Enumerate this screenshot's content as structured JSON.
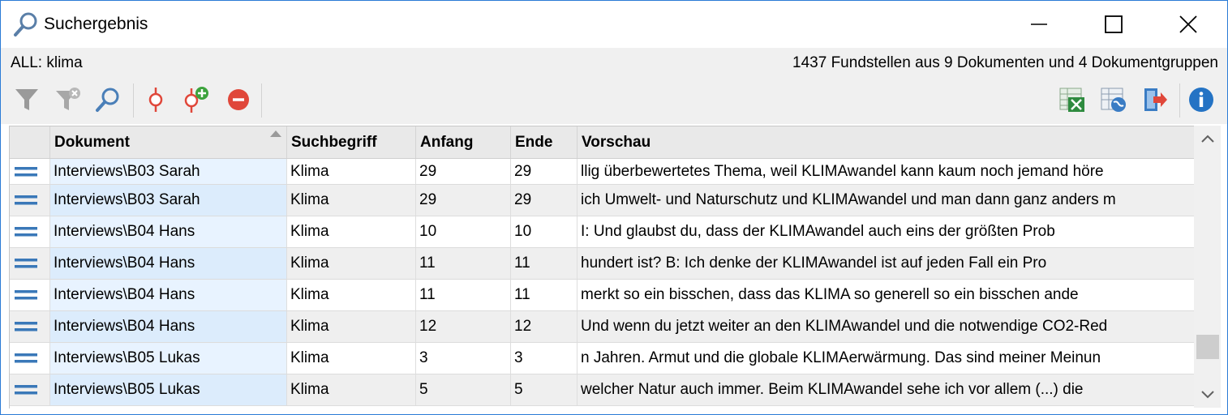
{
  "window": {
    "title": "Suchergebnis",
    "icon": "search-icon",
    "controls": [
      "minimize-icon",
      "maximize-icon",
      "close-icon"
    ]
  },
  "info": {
    "query": "ALL: klima",
    "summary": "1437 Fundstellen aus 9 Dokumenten und 4 Dokumentgruppen"
  },
  "toolbar": {
    "left": [
      "filter-icon",
      "remove-filter-icon",
      "search-icon",
      "code-icon",
      "add-code-icon",
      "remove-icon"
    ],
    "right": [
      "excel-export-icon",
      "web-export-icon",
      "export-icon",
      "info-icon"
    ]
  },
  "table": {
    "columns": [
      "",
      "Dokument",
      "Suchbegriff",
      "Anfang",
      "Ende",
      "Vorschau"
    ],
    "sorted_column": "Dokument",
    "rows": [
      {
        "doc": "Interviews\\B03 Sarah",
        "term": "Klima",
        "start": "29",
        "end": "29",
        "preview": "llig überbewertetes Thema, weil KLIMAwandel kann kaum noch jemand höre"
      },
      {
        "doc": "Interviews\\B03 Sarah",
        "term": "Klima",
        "start": "29",
        "end": "29",
        "preview": "ich Umwelt- und Naturschutz und KLIMAwandel und man dann ganz anders m"
      },
      {
        "doc": "Interviews\\B04 Hans",
        "term": "Klima",
        "start": "10",
        "end": "10",
        "preview": "I: Und glaubst du, dass der KLIMAwandel auch eins der größten Prob"
      },
      {
        "doc": "Interviews\\B04 Hans",
        "term": "Klima",
        "start": "11",
        "end": "11",
        "preview": "hundert ist?   B: Ich denke der KLIMAwandel ist auf jeden Fall ein Pro"
      },
      {
        "doc": "Interviews\\B04 Hans",
        "term": "Klima",
        "start": "11",
        "end": "11",
        "preview": "merkt so ein bisschen, dass das KLIMA so generell so ein bisschen ande"
      },
      {
        "doc": "Interviews\\B04 Hans",
        "term": "Klima",
        "start": "12",
        "end": "12",
        "preview": "Und wenn du jetzt weiter an den KLIMAwandel und die notwendige CO2-Red"
      },
      {
        "doc": "Interviews\\B05 Lukas",
        "term": "Klima",
        "start": "3",
        "end": "3",
        "preview": "n Jahren. Armut und die globale KLIMAerwärmung. Das sind meiner Meinun"
      },
      {
        "doc": "Interviews\\B05 Lukas",
        "term": "Klima",
        "start": "5",
        "end": "5",
        "preview": "welcher Natur auch immer. Beim KLIMAwandel sehe ich vor allem (...) die"
      }
    ]
  },
  "scroll": {
    "position": 0.89
  },
  "colors": {
    "accent_border": "#2b7bd6",
    "handle_blue": "#3a78b8",
    "code_red": "#e0473a",
    "add_green": "#3da33d",
    "excel_green": "#2e8b3f",
    "info_blue": "#2473c4",
    "doc_column_bg": "#e8f3ff"
  }
}
